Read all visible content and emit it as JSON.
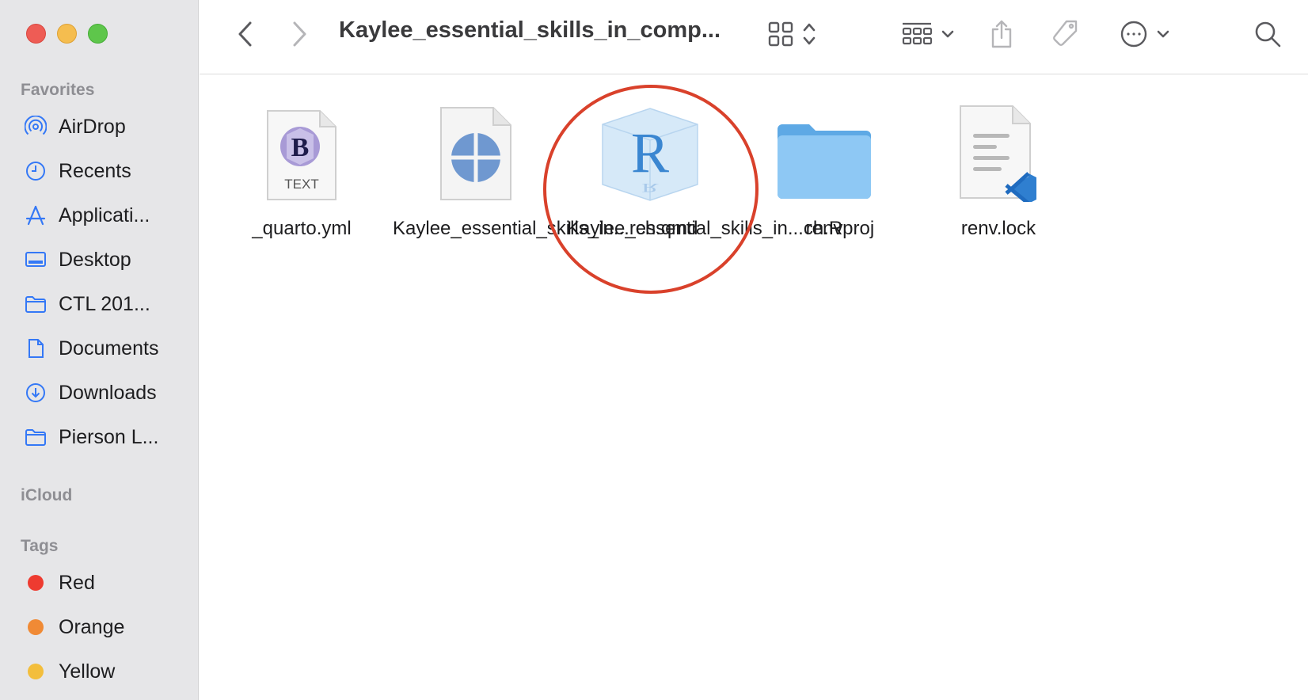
{
  "window": {
    "title": "Kaylee_essential_skills_in_comp..."
  },
  "sidebar": {
    "favorites_label": "Favorites",
    "favorites": [
      {
        "label": "AirDrop",
        "icon": "airdrop-icon"
      },
      {
        "label": "Recents",
        "icon": "clock-icon"
      },
      {
        "label": "Applicati...",
        "icon": "applications-icon"
      },
      {
        "label": "Desktop",
        "icon": "desktop-icon"
      },
      {
        "label": "CTL 201...",
        "icon": "folder-icon"
      },
      {
        "label": "Documents",
        "icon": "document-icon"
      },
      {
        "label": "Downloads",
        "icon": "download-icon"
      },
      {
        "label": "Pierson L...",
        "icon": "folder-icon"
      }
    ],
    "icloud_label": "iCloud",
    "tags_label": "Tags",
    "tags": [
      {
        "label": "Red",
        "color": "#ee3b30"
      },
      {
        "label": "Orange",
        "color": "#f08a35"
      },
      {
        "label": "Yellow",
        "color": "#f3be3c"
      }
    ]
  },
  "files": [
    {
      "name": "_quarto.yml",
      "icon": "text-file-icon",
      "badge": "TEXT"
    },
    {
      "name": "Kaylee_essential_skills_in...rch.qmd",
      "icon": "quarto-file-icon"
    },
    {
      "name": "Kaylee_essential_skills_in...ch.Rproj",
      "icon": "rproj-file-icon",
      "highlighted": true
    },
    {
      "name": "renv",
      "icon": "folder-icon"
    },
    {
      "name": "renv.lock",
      "icon": "vscode-file-icon"
    }
  ],
  "colors": {
    "accent": "#3478f6",
    "highlight_circle": "#d9412b",
    "sidebar_bg": "#e6e6e8"
  }
}
